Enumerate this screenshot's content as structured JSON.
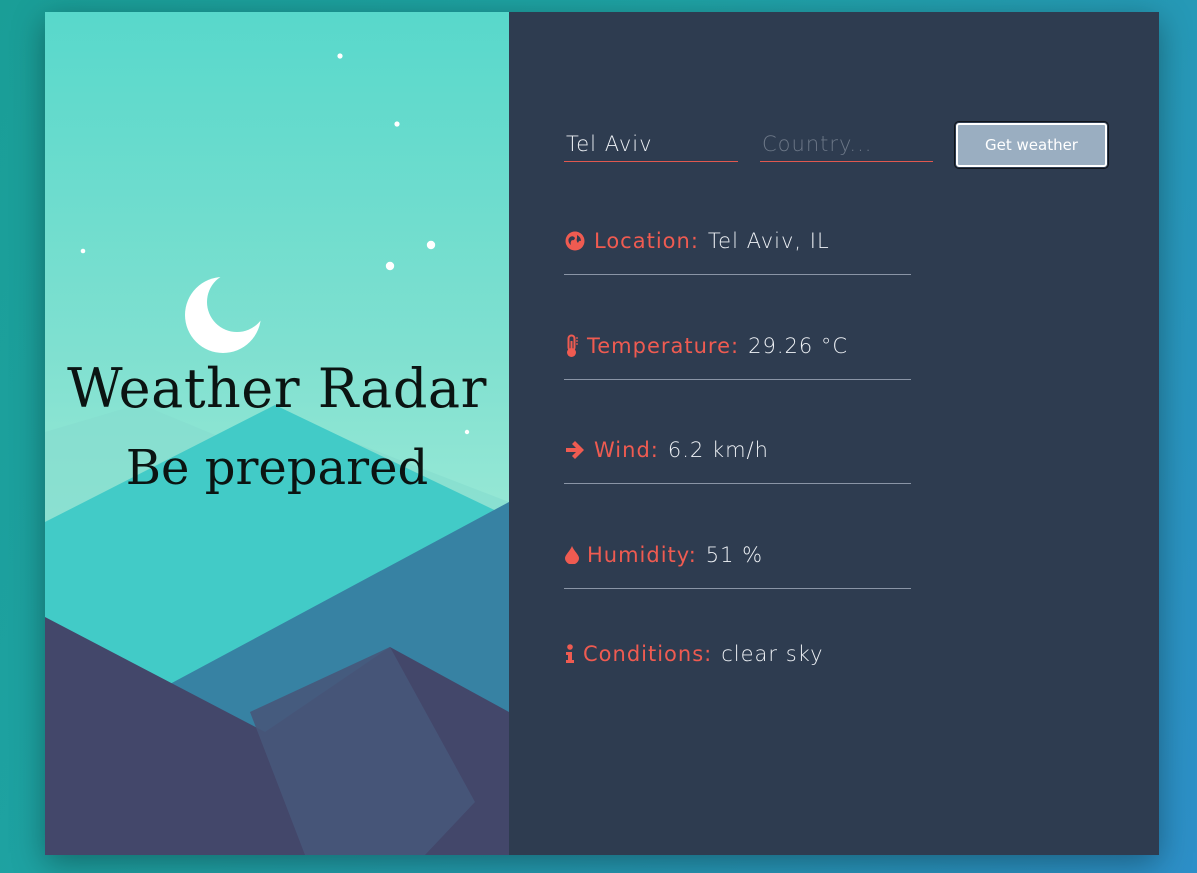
{
  "brand": {
    "title": "Weather Radar",
    "subtitle": "Be prepared"
  },
  "search": {
    "city_value": "Tel Aviv",
    "country_placeholder": "Country...",
    "button_label": "Get weather"
  },
  "details": {
    "location": {
      "label": "Location:",
      "value": "Tel Aviv, IL",
      "icon": "globe-icon"
    },
    "temperature": {
      "label": "Temperature:",
      "value": "29.26 °C",
      "icon": "thermometer-icon"
    },
    "wind": {
      "label": "Wind:",
      "value": "6.2 km/h",
      "icon": "arrow-right-icon"
    },
    "humidity": {
      "label": "Humidity:",
      "value": "51 %",
      "icon": "droplet-icon"
    },
    "conditions": {
      "label": "Conditions:",
      "value": "clear sky",
      "icon": "info-icon"
    }
  },
  "colors": {
    "accent": "#ef5b51",
    "panel": "#2e3c50",
    "button": "#9aaec1"
  }
}
